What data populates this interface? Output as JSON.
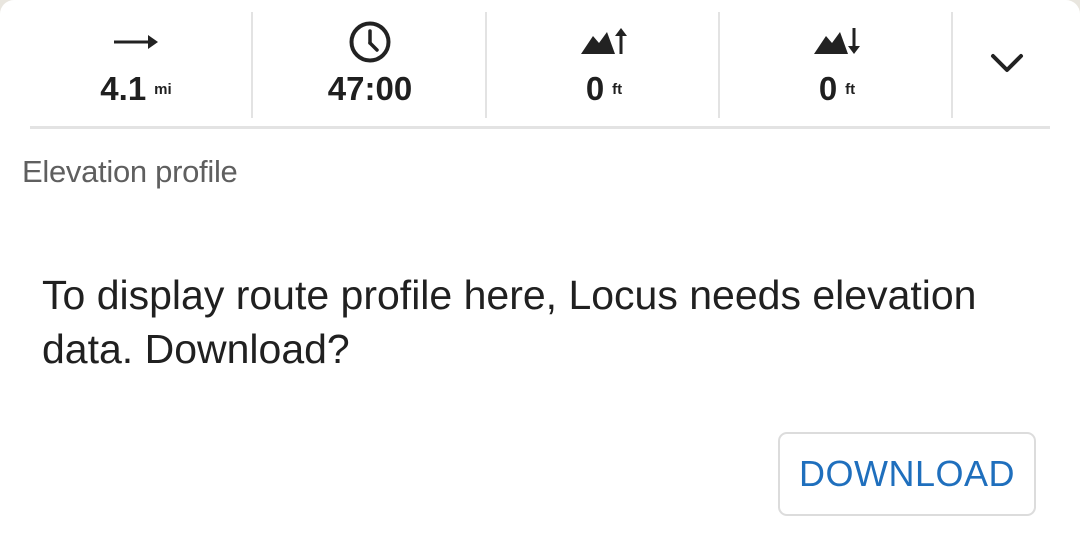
{
  "stats": [
    {
      "icon": "arrow-right-icon",
      "value": "4.1",
      "unit": "mi"
    },
    {
      "icon": "clock-icon",
      "value": "47:00",
      "unit": ""
    },
    {
      "icon": "elevation-ascent-icon",
      "value": "0",
      "unit": "ft"
    },
    {
      "icon": "elevation-descent-icon",
      "value": "0",
      "unit": "ft"
    }
  ],
  "expand": {
    "icon": "chevron-down-icon"
  },
  "elevation": {
    "title": "Elevation profile",
    "message": "To display route profile here, Locus needs elevation data. Download?",
    "download_label": "DOWNLOAD"
  },
  "colors": {
    "accent": "#1f6fbd",
    "text": "#1f1f1f",
    "muted": "#5f5f5f",
    "divider": "#e3e3e3"
  }
}
